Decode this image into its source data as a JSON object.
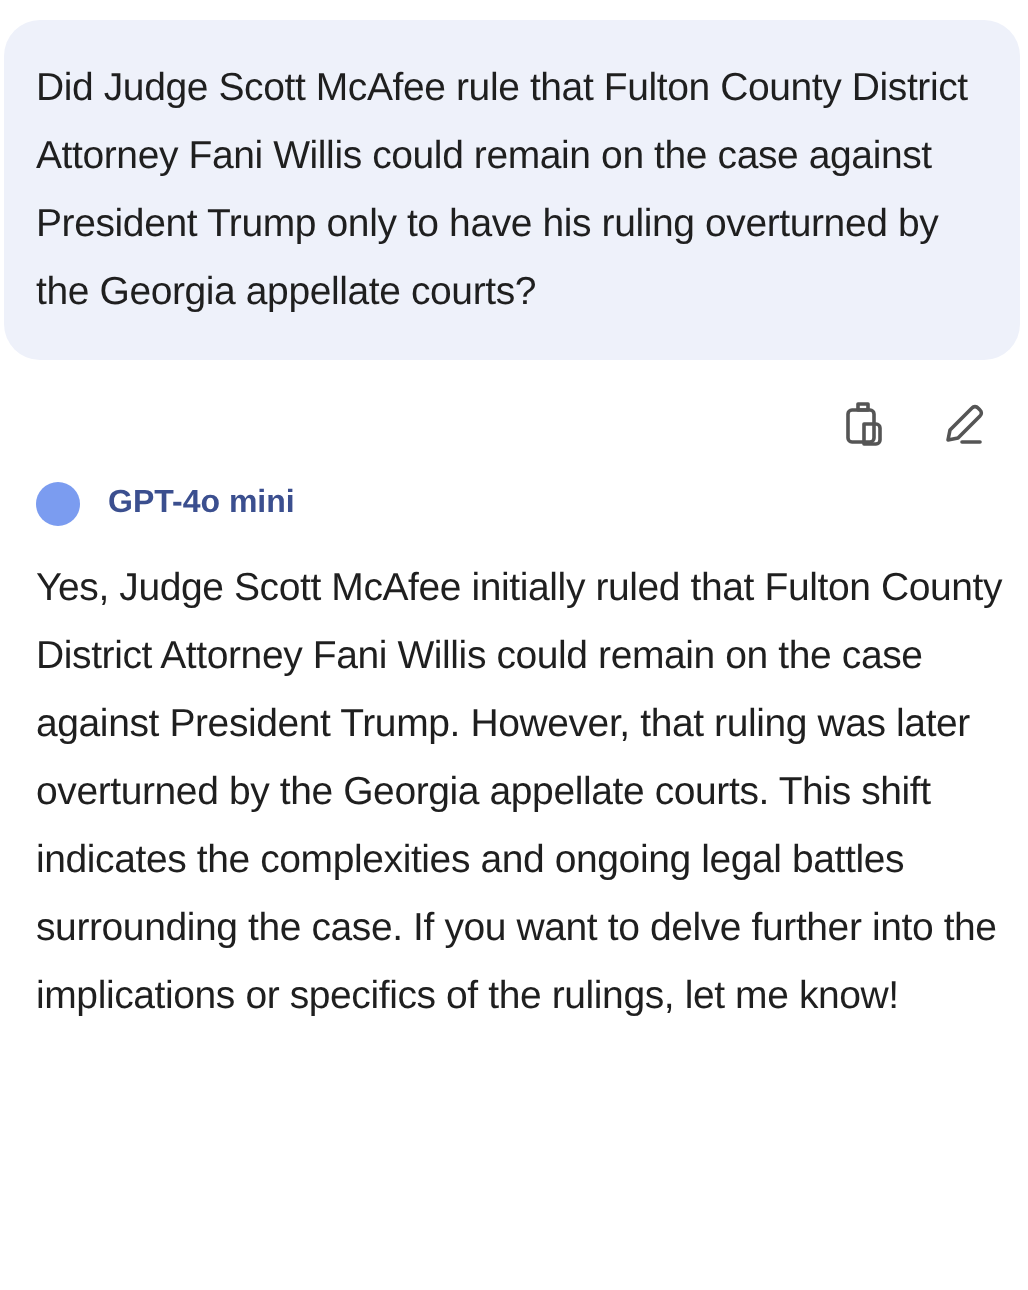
{
  "user_message": {
    "text": "Did Judge Scott McAfee rule that Fulton County District Attorney Fani Willis could remain on the case against President Trump only to have his ruling overturned by the Georgia appellate courts?"
  },
  "assistant": {
    "model": "GPT-4o mini",
    "text": "Yes, Judge Scott McAfee initially ruled that Fulton County District Attorney Fani Willis could remain on the case against President Trump. However, that ruling was later overturned by the Georgia appellate courts. This shift indicates the complexities and ongoing legal battles surrounding the case. If you want to delve further into the implications or specifics of the rulings, let me know!"
  }
}
